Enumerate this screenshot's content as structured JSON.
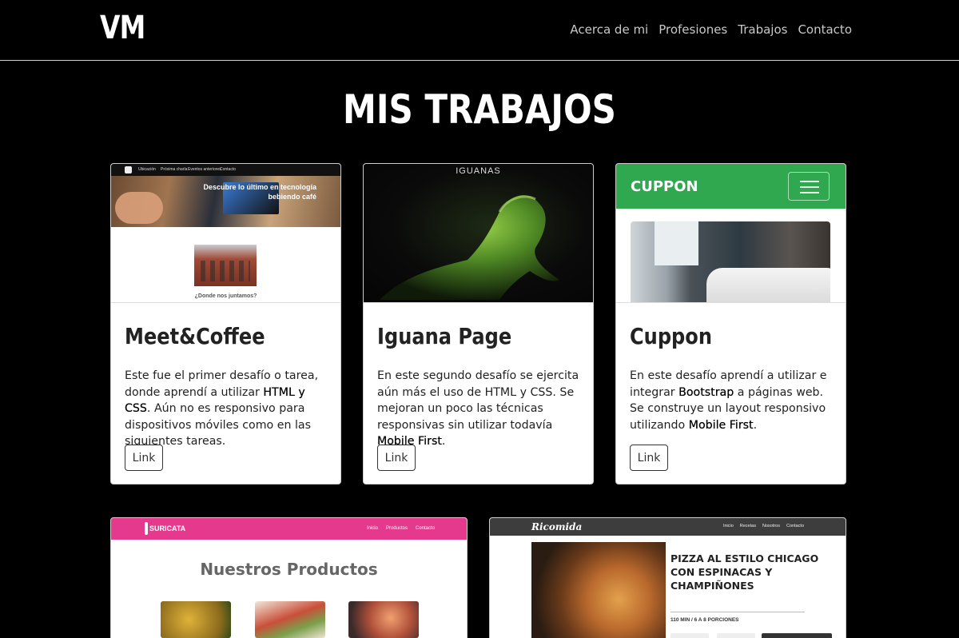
{
  "brand": "VM",
  "nav": [
    "Acerca de mi",
    "Profesiones",
    "Trabajos",
    "Contacto"
  ],
  "section_title": "MIS TRABAJOS",
  "cards": [
    {
      "title": "Meet&Coffee",
      "text_parts": [
        "Este fue el primer desafío o tarea, donde aprendí a utilizar ",
        "HTML y CSS",
        ". Aún no es responsivo para dispositivos móviles como en las siguientes tareas."
      ],
      "button": "Link",
      "shot": {
        "menu": [
          "Ubicación",
          "Próxima charla",
          "Eventos anteriores",
          "Contacto"
        ],
        "hero_text": "Descubre lo último en tecnología bebiendo café",
        "caption": "¿Donde nos juntamos?"
      }
    },
    {
      "title": "Iguana Page",
      "text_parts": [
        "En este segundo desafío se ejercita aún más el uso de HTML y CSS. Se mejoran un poco las técnicas responsivas sin utilizar todavía ",
        "Mobile First",
        "."
      ],
      "button": "Link",
      "shot": {
        "header": "IGUANAS"
      }
    },
    {
      "title": "Cuppon",
      "text_parts": [
        "En este desafío aprendí a utilizar e integrar ",
        "Bootstrap",
        " a páginas web. Se construye un layout responsivo utilizando ",
        "Mobile First",
        "."
      ],
      "button": "Link",
      "shot": {
        "logo": "CUPPON"
      }
    }
  ],
  "bottom_cards": [
    {
      "logo": "SURICATA",
      "menu": [
        "Inicio",
        "Productos",
        "Contacto"
      ],
      "title": "Nuestros Productos"
    },
    {
      "logo": "Ricomida",
      "menu": [
        "Inicio",
        "Recetas",
        "Nosotros",
        "Contacto"
      ],
      "title": "PIZZA AL ESTILO CHICAGO CON ESPINACAS Y CHAMPIÑONES",
      "meta": "110 MIN / 6 A 8 PORCIONES"
    }
  ],
  "colors": {
    "background": "#000000",
    "nav_link": "#c8c8c8",
    "cuppon_green": "#2fa84f",
    "suricata_pink": "#e5398e",
    "ricomida_bar": "#3d3d3d"
  }
}
